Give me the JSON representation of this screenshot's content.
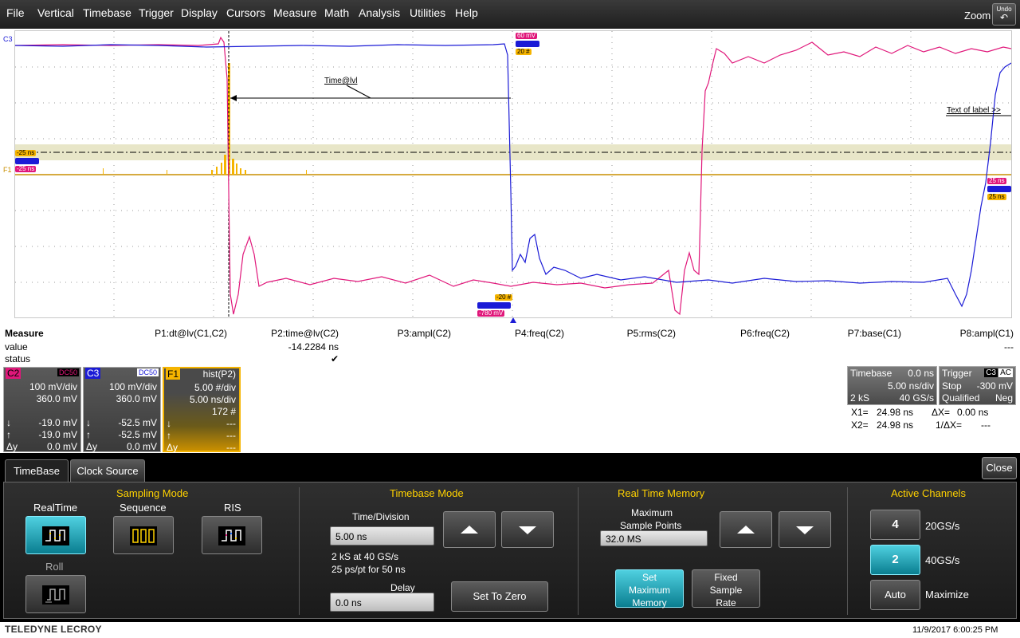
{
  "menu": [
    "File",
    "Vertical",
    "Timebase",
    "Trigger",
    "Display",
    "Cursors",
    "Measure",
    "Math",
    "Analysis",
    "Utilities",
    "Help"
  ],
  "zoom_label": "Zoom",
  "undo_label": "Undo",
  "grid": {
    "c3_label": "C3",
    "f1_label": "F1",
    "time_lvl_label": "Time@lvl",
    "text_of_label": "Text of label >>",
    "tags": {
      "top_pink": "60 mV",
      "top_amber": "20 #",
      "left_amber": "-25 ns",
      "left_pink": "-25 ns",
      "bottom_amber": "-20 #",
      "bottom_pink": "-780 mV",
      "right_pink": "25 ns",
      "right_amber": "25 ns"
    },
    "colors": {
      "c2": "#e0177a",
      "c3": "#1b1bd6",
      "f1": "#f5b400"
    }
  },
  "measure": {
    "title": "Measure",
    "row_value": "value",
    "row_status": "status",
    "params": [
      {
        "label": "P1:dt@lv(C1,C2)",
        "value": "",
        "status": ""
      },
      {
        "label": "P2:time@lv(C2)",
        "value": "-14.2284 ns",
        "status": "✔"
      },
      {
        "label": "P3:ampl(C2)",
        "value": "",
        "status": ""
      },
      {
        "label": "P4:freq(C2)",
        "value": "",
        "status": ""
      },
      {
        "label": "P5:rms(C2)",
        "value": "",
        "status": ""
      },
      {
        "label": "P6:freq(C2)",
        "value": "",
        "status": ""
      },
      {
        "label": "P7:base(C1)",
        "value": "",
        "status": ""
      },
      {
        "label": "P8:ampl(C1)",
        "value": "---",
        "status": ""
      }
    ]
  },
  "channels": {
    "c2": {
      "name": "C2",
      "coupling": "DC50",
      "vdiv": "100 mV/div",
      "offset": "360.0 mV",
      "down": "-19.0 mV",
      "up": "-19.0 mV",
      "dy": "0.0 mV"
    },
    "c3": {
      "name": "C3",
      "coupling": "DC50",
      "vdiv": "100 mV/div",
      "offset": "360.0 mV",
      "down": "-52.5 mV",
      "up": "-52.5 mV",
      "dy": "0.0 mV"
    },
    "f1": {
      "name": "F1",
      "func": "hist(P2)",
      "ydiv": "5.00 #/div",
      "xdiv": "5.00 ns/div",
      "count": "172 #",
      "down": "---",
      "up": "---",
      "dy": "---"
    }
  },
  "sym": {
    "down": "↓",
    "up": "↑",
    "dy": "Δy"
  },
  "timebase": {
    "title": "Timebase",
    "delay": "0.0 ns",
    "tdiv": "5.00 ns/div",
    "samples": "2 kS",
    "rate": "40 GS/s"
  },
  "trigger": {
    "title": "Trigger",
    "src": "C3",
    "coupling": "AC",
    "mode": "Stop",
    "level": "-300 mV",
    "state": "Qualified",
    "slope": "Neg"
  },
  "cursors": {
    "x1_label": "X1=",
    "x1": "24.98 ns",
    "dx_label": "ΔX=",
    "dx": "0.00 ns",
    "x2_label": "X2=",
    "x2": "24.98 ns",
    "invdx_label": "1/ΔX=",
    "invdx": "---"
  },
  "dialog": {
    "tabs": [
      "TimeBase",
      "Clock Source"
    ],
    "close": "Close",
    "sampling": {
      "title": "Sampling Mode",
      "realtime": "RealTime",
      "sequence": "Sequence",
      "ris": "RIS",
      "roll": "Roll"
    },
    "tbmode": {
      "title": "Timebase Mode",
      "tdiv_label": "Time/Division",
      "tdiv_value": "5.00 ns",
      "info1": "2 kS at 40 GS/s",
      "info2": "25 ps/pt for 50 ns",
      "delay_label": "Delay",
      "delay_value": "0.0 ns",
      "set_to_zero": "Set To Zero"
    },
    "rtmem": {
      "title": "Real Time Memory",
      "max_label_1": "Maximum",
      "max_label_2": "Sample Points",
      "max_value": "32.0 MS",
      "set_max_1": "Set",
      "set_max_2": "Maximum",
      "set_max_3": "Memory",
      "fixed_1": "Fixed",
      "fixed_2": "Sample",
      "fixed_3": "Rate"
    },
    "active": {
      "title": "Active Channels",
      "b4": "4",
      "l4": "20GS/s",
      "b2": "2",
      "l2": "40GS/s",
      "auto": "Auto",
      "lauto": "Maximize"
    }
  },
  "footer": {
    "brand": "TELEDYNE LECROY",
    "datetime": "11/9/2017 6:00:25 PM"
  }
}
